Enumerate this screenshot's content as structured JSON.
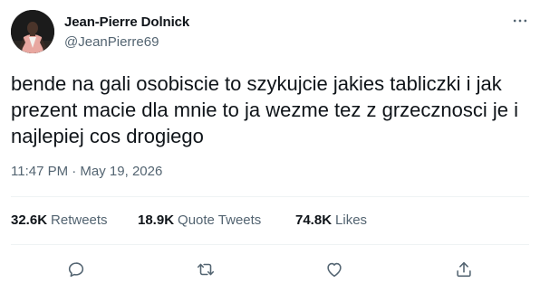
{
  "author": {
    "display_name": "Jean-Pierre Dolnick",
    "handle": "@JeanPierre69"
  },
  "tweet": {
    "text": "bende na gali osobiscie to szykujcie jakies tabliczki i jak prezent macie dla mnie to ja wezme tez z grzecznosci je i najlepiej cos drogiego",
    "timestamp": "11:47 PM · May 19, 2026"
  },
  "stats": {
    "retweets": {
      "count": "32.6K",
      "label": "Retweets"
    },
    "quotes": {
      "count": "18.9K",
      "label": "Quote Tweets"
    },
    "likes": {
      "count": "74.8K",
      "label": "Likes"
    }
  },
  "icons": {
    "more": "more-horizontal-icon",
    "reply": "reply-icon",
    "retweet": "retweet-icon",
    "like": "heart-icon",
    "share": "share-icon"
  },
  "colors": {
    "text_primary": "#0f1419",
    "text_secondary": "#536471",
    "divider": "#eff3f4",
    "avatar_jacket": "#e8a7a0"
  }
}
